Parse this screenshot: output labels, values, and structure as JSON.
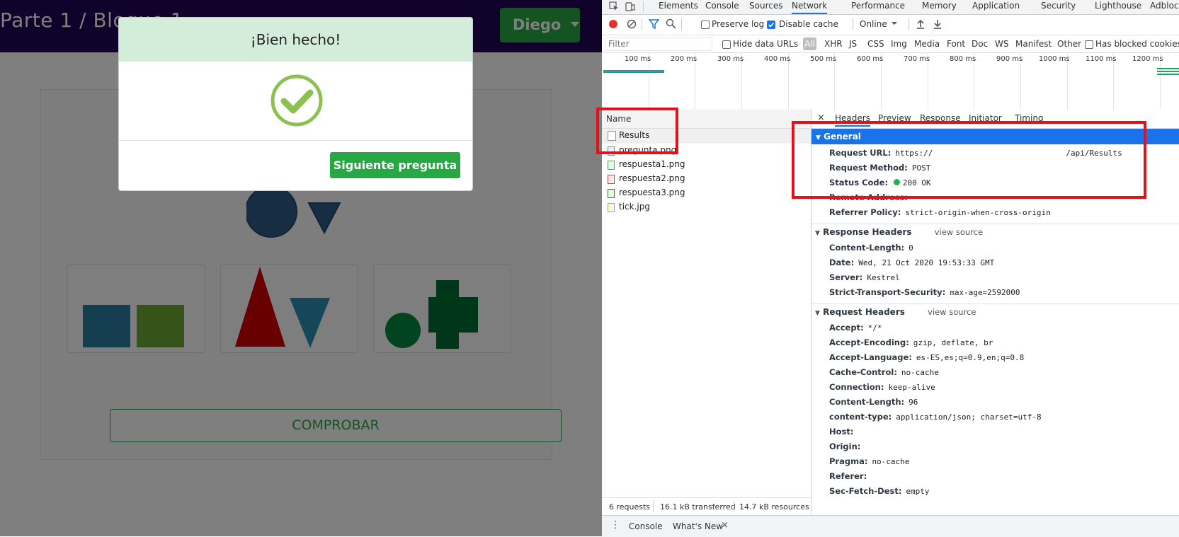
{
  "app": {
    "title": "Parte 1 / Bloque 1",
    "user": "Diego",
    "check_button": "COMPROBAR",
    "colors": {
      "nav": "#220557",
      "primary": "#28a745"
    }
  },
  "modal": {
    "title": "¡Bien hecho!",
    "next_button": "Siguiente pregunta",
    "icon": "check-circle-icon"
  },
  "devtools": {
    "tabs": [
      "Elements",
      "Console",
      "Sources",
      "Network",
      "Performance",
      "Memory",
      "Application",
      "Security",
      "Lighthouse",
      "Adblock Plu"
    ],
    "active_tab": "Network",
    "toolbar": {
      "preserve_log": "Preserve log",
      "disable_cache": "Disable cache",
      "throttling": "Online"
    },
    "filter": {
      "placeholder": "Filter",
      "hide_data_urls": "Hide data URLs",
      "types": [
        "All",
        "XHR",
        "JS",
        "CSS",
        "Img",
        "Media",
        "Font",
        "Doc",
        "WS",
        "Manifest",
        "Other"
      ],
      "has_blocked_cookies": "Has blocked cookies"
    },
    "timeline_ticks": [
      "100 ms",
      "200 ms",
      "300 ms",
      "400 ms",
      "500 ms",
      "600 ms",
      "700 ms",
      "800 ms",
      "900 ms",
      "1000 ms",
      "1100 ms",
      "1200 ms"
    ],
    "list": {
      "header": "Name",
      "rows": [
        "Results",
        "pregunta.png",
        "respuesta1.png",
        "respuesta2.png",
        "respuesta3.png",
        "tick.jpg"
      ],
      "status": {
        "requests": "6 requests",
        "transferred": "16.1 kB transferred",
        "resources": "14.7 kB resources"
      }
    },
    "detail_tabs": [
      "Headers",
      "Preview",
      "Response",
      "Initiator",
      "Timing"
    ],
    "general": {
      "title": "General",
      "request_url_label": "Request URL:",
      "request_url_start": "https://",
      "request_url_end": "/api/Results",
      "method_label": "Request Method:",
      "method": "POST",
      "status_label": "Status Code:",
      "status": "200 OK",
      "remote_label": "Remote Address:",
      "referrer_label": "Referrer Policy:",
      "referrer": "strict-origin-when-cross-origin"
    },
    "response_headers": {
      "title": "Response Headers",
      "view_source": "view source",
      "items": [
        {
          "k": "Content-Length:",
          "v": "0"
        },
        {
          "k": "Date:",
          "v": "Wed, 21 Oct 2020 19:53:33 GMT"
        },
        {
          "k": "Server:",
          "v": "Kestrel"
        },
        {
          "k": "Strict-Transport-Security:",
          "v": "max-age=2592000"
        }
      ]
    },
    "request_headers": {
      "title": "Request Headers",
      "view_source": "view source",
      "items": [
        {
          "k": "Accept:",
          "v": "*/*"
        },
        {
          "k": "Accept-Encoding:",
          "v": "gzip, deflate, br"
        },
        {
          "k": "Accept-Language:",
          "v": "es-ES,es;q=0.9,en;q=0.8"
        },
        {
          "k": "Cache-Control:",
          "v": "no-cache"
        },
        {
          "k": "Connection:",
          "v": "keep-alive"
        },
        {
          "k": "Content-Length:",
          "v": "96"
        },
        {
          "k": "content-type:",
          "v": "application/json; charset=utf-8"
        },
        {
          "k": "Host:",
          "v": ""
        },
        {
          "k": "Origin:",
          "v": ""
        },
        {
          "k": "Pragma:",
          "v": "no-cache"
        },
        {
          "k": "Referer:",
          "v": ""
        },
        {
          "k": "Sec-Fetch-Dest:",
          "v": "empty"
        }
      ]
    },
    "drawer_tabs": [
      "Console",
      "What's New"
    ]
  }
}
